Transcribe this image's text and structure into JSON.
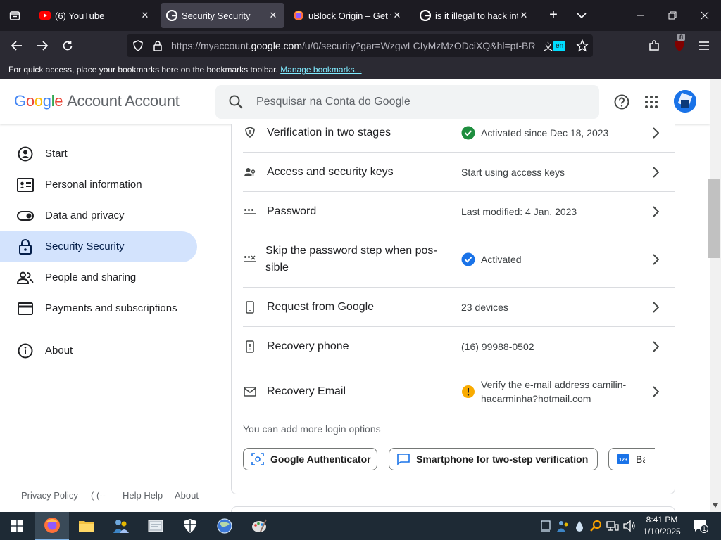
{
  "browser": {
    "tabs": [
      {
        "title": "(6) YouTube",
        "favicon": "youtube-icon",
        "active": false
      },
      {
        "title": "Security Security",
        "favicon": "google-icon",
        "active": true
      },
      {
        "title": "uBlock Origin – Get thi",
        "favicon": "firefox-icon",
        "active": false
      },
      {
        "title": "is it illegal to hack into",
        "favicon": "google-icon",
        "active": false
      }
    ],
    "url_prefix": "https://myaccount.",
    "url_domain": "google.com",
    "url_suffix": "/u/0/security?gar=WzgwLCIyMzMzODciXQ&hl=pt-BR",
    "translate_lang": "en",
    "extension_badge": "8",
    "bookmarks_message": "For quick access, place your bookmarks here on the bookmarks toolbar.",
    "bookmarks_link": "Manage bookmarks..."
  },
  "header": {
    "logo_word": "Google",
    "product_name": "Account Account",
    "search_placeholder": "Pesquisar na Conta do Google"
  },
  "sidebar": {
    "items": [
      {
        "label": "Start",
        "icon": "account-circle-icon",
        "active": false
      },
      {
        "label": "Personal information",
        "icon": "id-card-icon",
        "active": false
      },
      {
        "label": "Data and privacy",
        "icon": "toggle-icon",
        "active": false
      },
      {
        "label": "Security Security",
        "icon": "lock-icon",
        "active": true
      },
      {
        "label": "People and sharing",
        "icon": "people-icon",
        "active": false
      },
      {
        "label": "Payments and subscriptions",
        "icon": "credit-card-icon",
        "active": false
      },
      {
        "label": "About",
        "icon": "info-icon",
        "active": false
      }
    ],
    "footer": [
      "Privacy Policy",
      "( (--",
      "Help Help",
      "About"
    ]
  },
  "security": {
    "rows": [
      {
        "label": "Verification in two stages",
        "value": "Activated since Dec 18, 2023",
        "status": "success",
        "icon": "shield-icon"
      },
      {
        "label": "Access and security keys",
        "value": "Start using access keys",
        "status": "",
        "icon": "person-key-icon"
      },
      {
        "label": "Password",
        "value": "Last modified: 4 Jan. 2023",
        "status": "",
        "icon": "password-dots-icon"
      },
      {
        "label": "Skip the password step when pos-\nsible",
        "value": "Activated",
        "status": "verified",
        "icon": "password-skip-icon"
      },
      {
        "label": "Request from Google",
        "value": "23 devices",
        "status": "",
        "icon": "phone-icon"
      },
      {
        "label": "Recovery phone",
        "value": "(16) 99988-0502",
        "status": "",
        "icon": "recovery-phone-icon"
      },
      {
        "label": "Recovery Email",
        "value": "Verify the e-mail address camilin-\nhacarminha?hotmail.com",
        "status": "warning",
        "icon": "mail-icon"
      }
    ],
    "more_options_text": "You can add more login options",
    "options": [
      "Google Authenticator",
      "Smartphone for two-step verification",
      "Backup codes"
    ]
  },
  "taskbar": {
    "time": "8:41 PM",
    "date": "1/10/2025",
    "notification_count": "1"
  },
  "colors": {
    "google_blue": "#4285f4",
    "google_red": "#ea4335",
    "google_yellow": "#fbbc04",
    "google_green": "#34a853",
    "success": "#1e8e3e",
    "verified": "#1a73e8",
    "warning": "#f9ab00",
    "active_nav": "#d3e3fd"
  }
}
